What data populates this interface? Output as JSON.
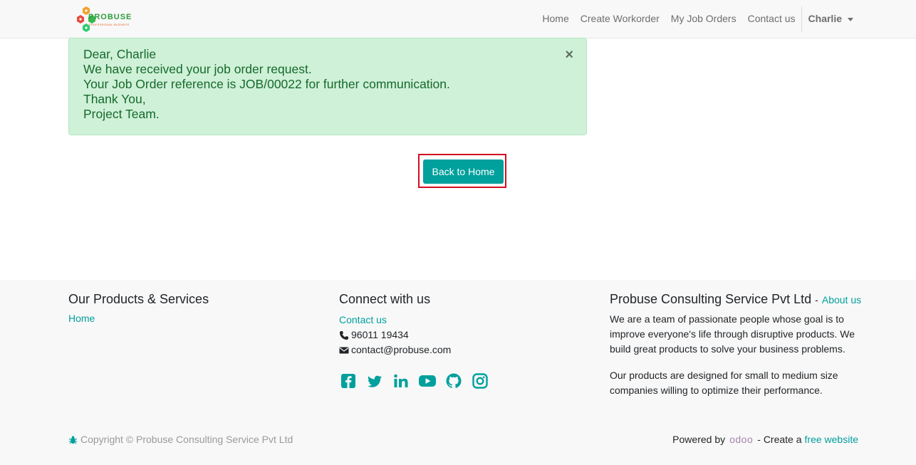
{
  "brand": {
    "name": "PROBUSE",
    "tagline": "PROFESSIONAL BUSINESS"
  },
  "nav": {
    "items": [
      {
        "label": "Home"
      },
      {
        "label": "Create Workorder"
      },
      {
        "label": "My Job Orders"
      },
      {
        "label": "Contact us"
      }
    ],
    "user": "Charlie"
  },
  "alert": {
    "lines": [
      "Dear, Charlie",
      "We have received your job order request.",
      "Your Job Order reference is JOB/00022 for further communication.",
      "Thank You,",
      "Project Team."
    ],
    "close": "×"
  },
  "main": {
    "back_button": "Back to Home"
  },
  "footer": {
    "col1": {
      "title": "Our Products & Services",
      "link": "Home"
    },
    "col2": {
      "title": "Connect with us",
      "link": "Contact us",
      "phone": "96011 19434",
      "email": "contact@probuse.com",
      "social": [
        "facebook-icon",
        "twitter-icon",
        "linkedin-icon",
        "youtube-icon",
        "github-icon",
        "instagram-icon"
      ]
    },
    "col3": {
      "title": "Probuse Consulting Service Pvt Ltd",
      "sep": "-",
      "about_link": "About us",
      "p1": "We are a team of passionate people whose goal is to improve everyone's life through disruptive products. We build great products to solve your business problems.",
      "p2": "Our products are designed for small to medium size companies willing to optimize their performance."
    },
    "copyright": "Copyright © Probuse Consulting Service Pvt Ltd",
    "powered_by": "Powered by",
    "odoo": "odoo",
    "create_a": "- Create a",
    "free_website": "free website"
  },
  "colors": {
    "accent": "#00a09d",
    "alert_bg": "#cff1d8",
    "alert_text": "#16692b",
    "highlight": "#d10f1f"
  }
}
